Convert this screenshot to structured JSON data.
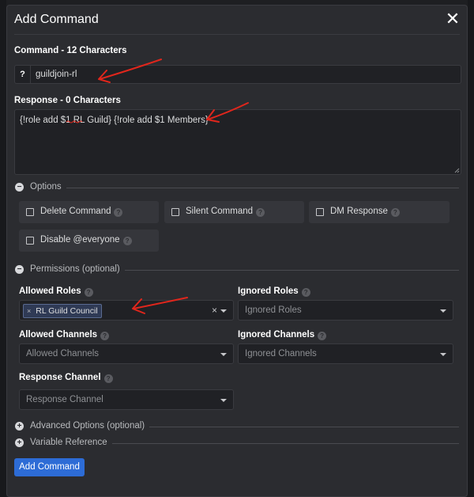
{
  "modal": {
    "title": "Add Command",
    "close_glyph": "✕"
  },
  "command": {
    "label": "Command - 12 Characters",
    "prefix": "?",
    "value": "guildjoin-rl"
  },
  "response": {
    "label": "Response - 0 Characters",
    "value": "{!role add $1 RL Guild} {!role add $1 Members}"
  },
  "options": {
    "title": "Options",
    "collapse_glyph": "−",
    "items": [
      {
        "label": "Delete Command",
        "checked": false
      },
      {
        "label": "Silent Command",
        "checked": false
      },
      {
        "label": "DM Response",
        "checked": false
      },
      {
        "label": "Disable @everyone",
        "checked": false
      }
    ]
  },
  "permissions": {
    "title": "Permissions (optional)",
    "collapse_glyph": "−",
    "allowed_roles": {
      "label": "Allowed Roles",
      "selected": [
        "RL Guild Council"
      ],
      "clear_glyph": "×",
      "tag_remove_glyph": "×"
    },
    "ignored_roles": {
      "label": "Ignored Roles",
      "placeholder": "Ignored Roles"
    },
    "allowed_channels": {
      "label": "Allowed Channels",
      "placeholder": "Allowed Channels"
    },
    "ignored_channels": {
      "label": "Ignored Channels",
      "placeholder": "Ignored Channels"
    },
    "response_channel": {
      "label": "Response Channel",
      "placeholder": "Response Channel"
    }
  },
  "advanced": {
    "title": "Advanced Options (optional)",
    "expand_glyph": "+"
  },
  "variables": {
    "title": "Variable Reference",
    "expand_glyph": "+"
  },
  "submit": {
    "label": "Add Command"
  },
  "colors": {
    "accent": "#2d6cd6",
    "annotation": "#e0261c",
    "modal_bg": "#2b2c30"
  },
  "help_glyph": "?"
}
